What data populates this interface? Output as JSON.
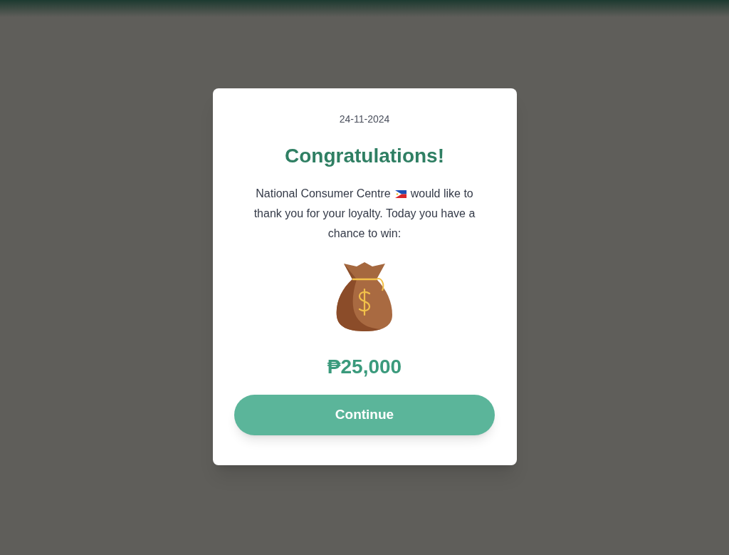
{
  "dialog": {
    "date": "24-11-2024",
    "title": "Congratulations!",
    "message": [
      "National Consumer Centre",
      "would like to",
      "thank you for your loyalty. Today you have a",
      "chance to win:"
    ],
    "prize": "₱25,000",
    "button": "Continue"
  }
}
